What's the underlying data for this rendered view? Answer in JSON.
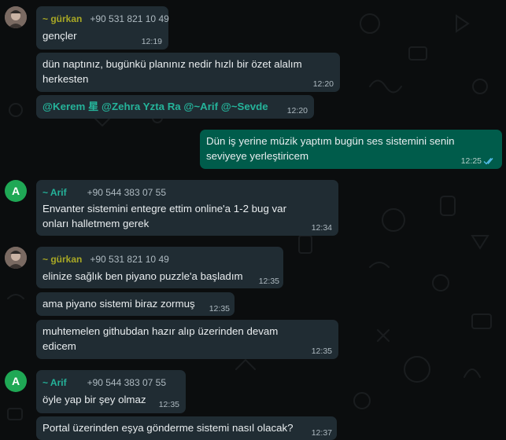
{
  "messages": [
    {
      "sender": "~ gürkan",
      "phone": "+90 531 821 10 49",
      "text": "gençler",
      "time": "12:19"
    },
    {
      "line1": "dün naptınız, bugünkü planınız nedir hızlı bir özet alalım",
      "line2": "herkesten",
      "time": "12:20"
    },
    {
      "mentions": "@Kerem 星 @Zehra Yzta Ra @~Arif @~Sevde",
      "time": "12:20"
    },
    {
      "line1": "Dün iş yerine müzik yaptım bugün ses sistemini senin",
      "line2": "seviyeye yerleştiricem",
      "time": "12:25"
    },
    {
      "avatar_letter": "A",
      "sender": "~ Arif",
      "phone": "+90 544 383 07 55",
      "line1": "Envanter sistemini entegre ettim online'a 1-2 bug var",
      "line2": "onları halletmem gerek",
      "time": "12:34"
    },
    {
      "sender": "~ gürkan",
      "phone": "+90 531 821 10 49",
      "text": "elinize sağlık ben piyano puzzle'a başladım",
      "time": "12:35"
    },
    {
      "text": "ama piyano sistemi biraz zormuş",
      "time": "12:35"
    },
    {
      "line1": "muhtemelen githubdan hazır alıp üzerinden devam",
      "line2": "edicem",
      "time": "12:35"
    },
    {
      "avatar_letter": "A",
      "sender": "~ Arif",
      "phone": "+90 544 383 07 55",
      "text": "öyle yap bir şey olmaz",
      "time": "12:35"
    },
    {
      "text": "Portal üzerinden eşya gönderme sistemi nasıl olacak?",
      "time": "12:37"
    }
  ],
  "colors": {
    "incoming": "#202c33",
    "outgoing": "#005c4b",
    "gurkan": "#a8a825",
    "arif": "#25b39a",
    "read_ticks": "#53bdeb"
  },
  "icons": [
    "user-photo-avatar",
    "read-receipt-double-check-icon"
  ]
}
